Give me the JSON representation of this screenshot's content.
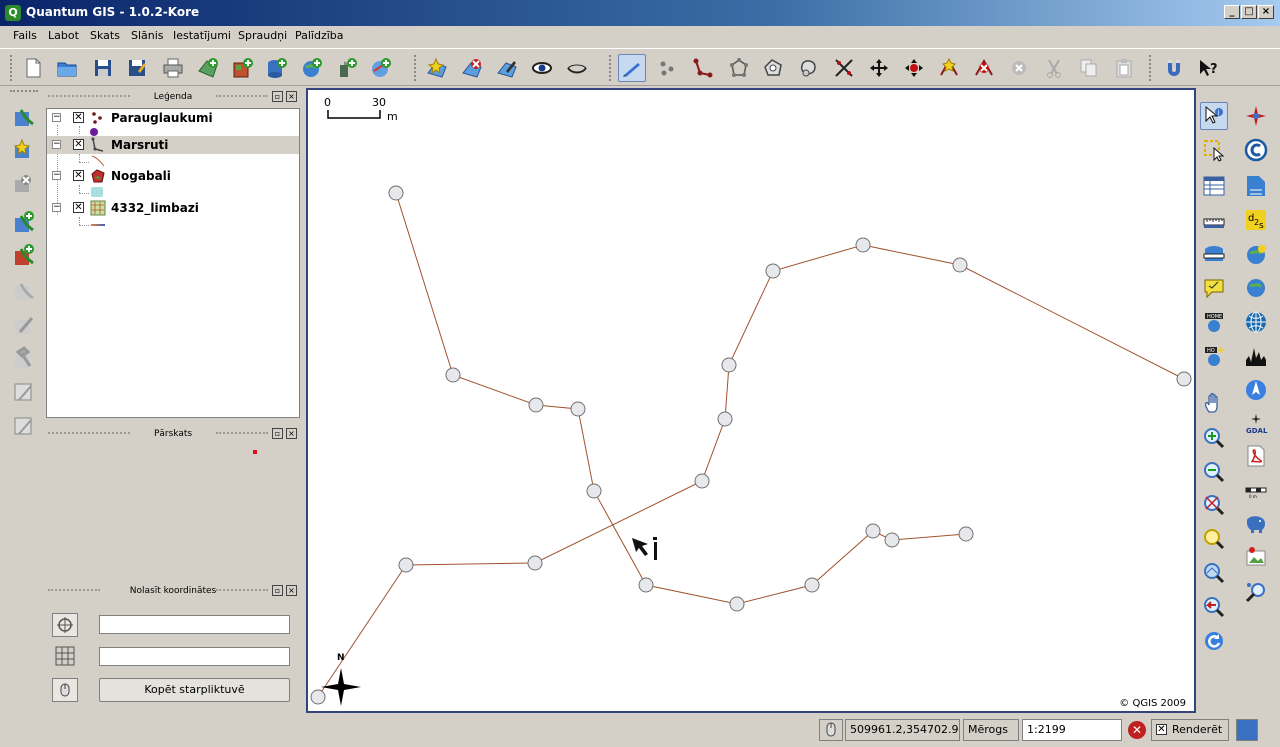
{
  "window": {
    "title": "Quantum GIS - 1.0.2-Kore",
    "app_icon": "Q"
  },
  "menu": [
    "Fails",
    "Labot",
    "Skats",
    "Slānis",
    "Iestatījumi",
    "Spraudņi",
    "Palīdzība"
  ],
  "toolbar": {
    "buttons": [
      "new-project",
      "open-project",
      "save-project",
      "save-as",
      "print",
      "add-vector",
      "add-raster",
      "add-postgis",
      "add-wms",
      "add-wfs",
      "add-spatialite",
      "new-layer",
      "remove-layer",
      "toggle-editing",
      "show-all",
      "hide-all",
      "digitize",
      "capture-point",
      "capture-line",
      "capture-polygon",
      "add-ring",
      "add-island",
      "split",
      "move-feature",
      "move-vertex",
      "add-vertex",
      "delete-vertex",
      "delete",
      "cut",
      "copy",
      "paste",
      "plugin",
      "whats-this"
    ],
    "active": "digitize"
  },
  "dock": {
    "legend": {
      "title": "Leģenda",
      "layers": [
        {
          "name": "Parauglaukumi",
          "checked": true,
          "selected": false,
          "symbol_color": "#6a1a9a"
        },
        {
          "name": "Marsruti",
          "checked": true,
          "selected": true,
          "symbol_color": "#b06040"
        },
        {
          "name": "Nogabali",
          "checked": true,
          "selected": false,
          "symbol_color": "#a8e0e0"
        },
        {
          "name": "4332_limbazi",
          "checked": true,
          "selected": false,
          "symbol_color": "#e08040"
        }
      ]
    },
    "overview": {
      "title": "Pārskats"
    },
    "coords": {
      "title": "Nolasīt koordinātes",
      "copy_label": "Kopēt starpliktuvē",
      "field1": "",
      "field2": ""
    }
  },
  "map": {
    "scalebar": {
      "start": "0",
      "end": "30",
      "unit": "m"
    },
    "north_label": "N",
    "copyright": "© QGIS 2009"
  },
  "status": {
    "coords": "509961.2,354702.9",
    "scale_label": "Mērogs",
    "scale_value": "1:2199",
    "render_label": "Renderēt",
    "render_checked": true
  },
  "colors": {
    "route": "#a0522d",
    "vertex_fill": "#e6e8ec",
    "vertex_stroke": "#707070",
    "map_border": "#34447c"
  }
}
